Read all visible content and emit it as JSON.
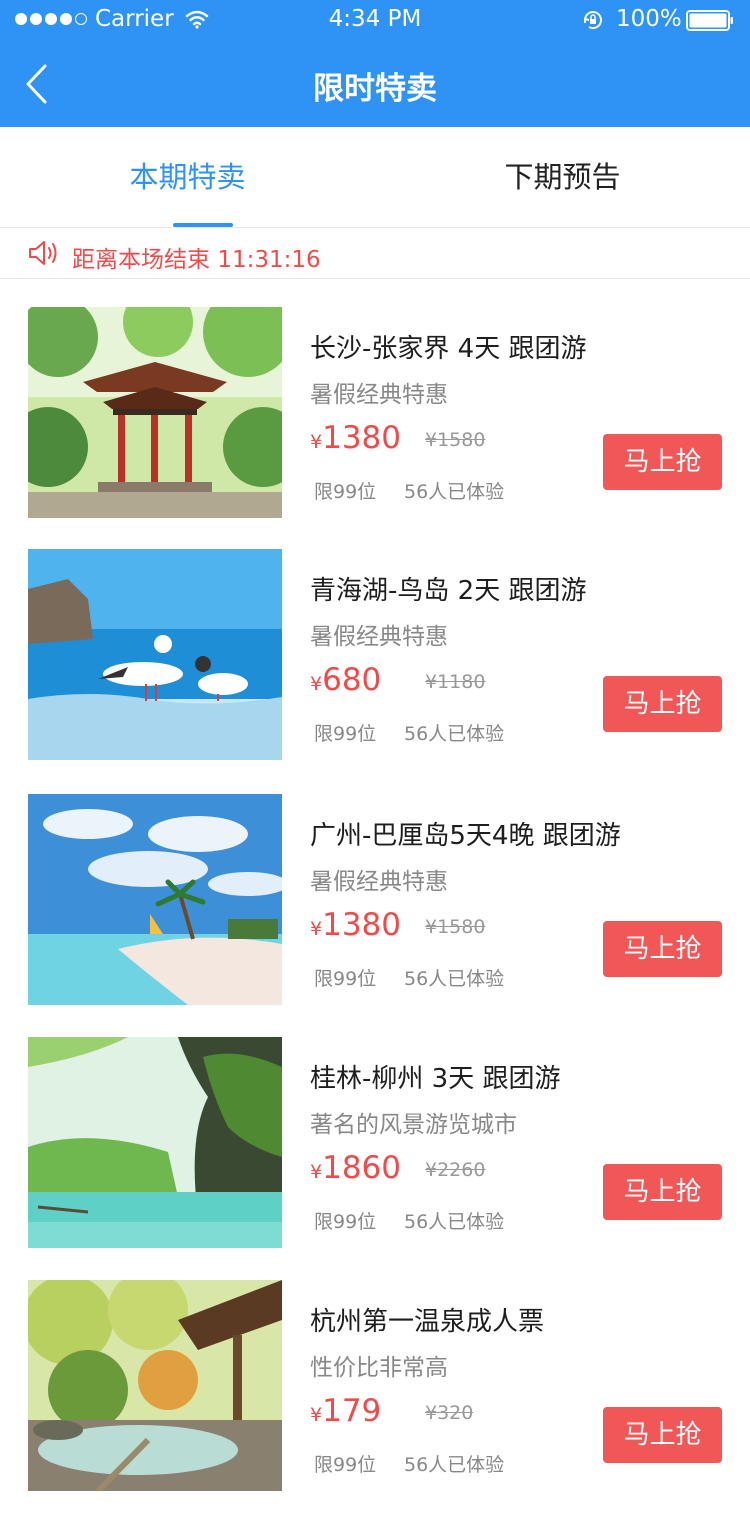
{
  "status_bar": {
    "carrier": "Carrier",
    "time": "4:34 PM",
    "battery": "100%"
  },
  "header": {
    "title": "限时特卖",
    "back_icon": "chevron-left-icon"
  },
  "tabs": [
    {
      "label": "本期特卖",
      "active": true
    },
    {
      "label": "下期预告",
      "active": false
    }
  ],
  "countdown": {
    "icon": "speaker-icon",
    "label": "距离本场结束",
    "time": "11:31:16"
  },
  "colors": {
    "primary": "#2f93f5",
    "accent": "#ef4b4b",
    "button": "#f25757"
  },
  "items": [
    {
      "title": "长沙-张家界 4天 跟团游",
      "subtitle": "暑假经典特惠",
      "currency": "¥",
      "price": "1380",
      "old_price": "¥1580",
      "limit": "限99位",
      "experienced": "56人已体验",
      "button": "马上抢"
    },
    {
      "title": "青海湖-鸟岛 2天 跟团游",
      "subtitle": "暑假经典特惠",
      "currency": "¥",
      "price": "680",
      "old_price": "¥1180",
      "limit": "限99位",
      "experienced": "56人已体验",
      "button": "马上抢"
    },
    {
      "title": "广州-巴厘岛5天4晚 跟团游",
      "subtitle": "暑假经典特惠",
      "currency": "¥",
      "price": "1380",
      "old_price": "¥1580",
      "limit": "限99位",
      "experienced": "56人已体验",
      "button": "马上抢"
    },
    {
      "title": "桂林-柳州 3天 跟团游",
      "subtitle": "著名的风景游览城市",
      "currency": "¥",
      "price": "1860",
      "old_price": "¥2260",
      "limit": "限99位",
      "experienced": "56人已体验",
      "button": "马上抢"
    },
    {
      "title": "杭州第一温泉成人票",
      "subtitle": "性价比非常高",
      "currency": "¥",
      "price": "179",
      "old_price": "¥320",
      "limit": "限99位",
      "experienced": "56人已体验",
      "button": "马上抢"
    }
  ]
}
